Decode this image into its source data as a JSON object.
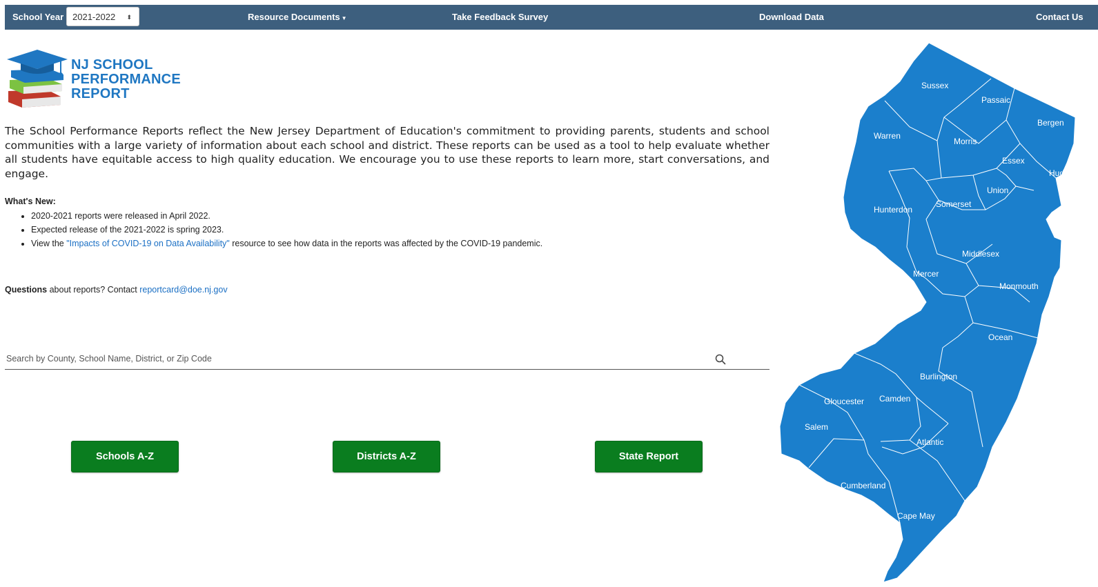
{
  "nav": {
    "school_year_label": "School Year",
    "school_year_value": "2021-2022",
    "resource_documents": "Resource Documents",
    "feedback_survey": "Take Feedback Survey",
    "download_data": "Download Data",
    "contact_us": "Contact Us"
  },
  "logo": {
    "line1": "NJ SCHOOL",
    "line2": "PERFORMANCE",
    "line3": "REPORT"
  },
  "intro": "The School Performance Reports reflect the New Jersey Department of Education's commitment to providing parents, students and school communities with a large variety of information about each school and district. These reports can be used as a tool to help evaluate whether all students have equitable access to high quality education. We encourage you to use these reports to learn more, start conversations, and engage.",
  "whats_new": {
    "title": "What's New:",
    "item1": "2020-2021 reports were released in April 2022.",
    "item2": "Expected release of the 2021-2022 is spring 2023.",
    "item3_prefix": "View the ",
    "item3_link": "\"Impacts of COVID-19 on Data Availability\"",
    "item3_suffix": " resource to see how data in the reports was affected by the COVID-19 pandemic."
  },
  "questions": {
    "bold": "Questions",
    "text": " about reports? Contact ",
    "email": "reportcard@doe.nj.gov"
  },
  "search": {
    "placeholder": "Search by County, School Name, District, or Zip Code"
  },
  "buttons": {
    "schools": "Schools A-Z",
    "districts": "Districts A-Z",
    "state": "State Report"
  },
  "map": {
    "fill_color": "#1b7fcc",
    "counties": [
      "Sussex",
      "Passaic",
      "Bergen",
      "Warren",
      "Morris",
      "Essex",
      "Hudson",
      "Union",
      "Somerset",
      "Hunterdon",
      "Middlesex",
      "Mercer",
      "Monmouth",
      "Ocean",
      "Burlington",
      "Camden",
      "Gloucester",
      "Salem",
      "Atlantic",
      "Cumberland",
      "Cape May"
    ]
  },
  "colors": {
    "navbar": "#3d5f7e",
    "button": "#0a7d1f",
    "link": "#1a6fc4",
    "logo_text": "#1f77c2"
  }
}
